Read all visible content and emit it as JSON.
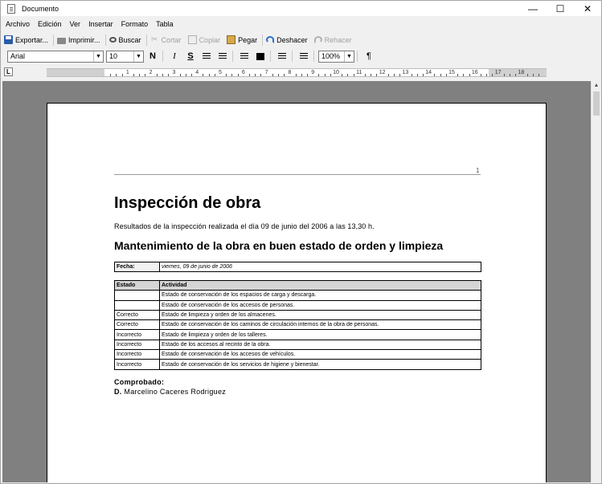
{
  "window": {
    "title": "Documento",
    "controls": [
      "—",
      "☐",
      "✕"
    ]
  },
  "menu": [
    "Archivo",
    "Edición",
    "Ver",
    "Insertar",
    "Formato",
    "Tabla"
  ],
  "toolbar": {
    "export": "Exportar...",
    "print": "Imprimir...",
    "find": "Buscar",
    "cut": "Cortar",
    "copy": "Copiar",
    "paste": "Pegar",
    "undo": "Deshacer",
    "redo": "Rehacer"
  },
  "format": {
    "font": "Arial",
    "size": "10",
    "bold": "N",
    "italic": "I",
    "strike": "S",
    "zoom": "100%",
    "pilcrow": "¶",
    "tab_stop": "L"
  },
  "ruler": {
    "labels": [
      "1",
      "2",
      "3",
      "4",
      "5",
      "6",
      "7",
      "8",
      "9",
      "10",
      "11",
      "12",
      "13",
      "14",
      "15",
      "16",
      "17",
      "18"
    ]
  },
  "document": {
    "page_number": "1",
    "title": "Inspección de obra",
    "intro": "Resultados de la inspección realizada el día 09 de junio del 2006 a las 13,30 h.",
    "heading": "Mantenimiento de la obra en buen estado de orden y limpieza",
    "fecha_label": "Fecha:",
    "fecha_value": "viernes, 09 de junio de 2006",
    "table_headers": [
      "Estado",
      "Actividad"
    ],
    "rows": [
      {
        "estado": "",
        "actividad": "Estado de conservación de los espacios de carga y descarga."
      },
      {
        "estado": "",
        "actividad": "Estado de conservación de los accesos de personas."
      },
      {
        "estado": "Correcto",
        "actividad": "Estado de limpieza y orden de los almacenes."
      },
      {
        "estado": "Correcto",
        "actividad": "Estado de conservación de los caminos de circulación internos de la obra de personas."
      },
      {
        "estado": "Incorrecto",
        "actividad": "Estado de limpieza y orden de los talleres."
      },
      {
        "estado": "Incorrecto",
        "actividad": "Estado de los accesos al recinto de la obra."
      },
      {
        "estado": "Incorrecto",
        "actividad": "Estado de conservación de los accesos de vehículos."
      },
      {
        "estado": "Incorrecto",
        "actividad": "Estado de conservación de los servicios de higiene y bienestar."
      }
    ],
    "comprobado": "Comprobado:",
    "firmante_prefix": "D.",
    "firmante_name": "Marcelino Caceres Rodriguez"
  }
}
